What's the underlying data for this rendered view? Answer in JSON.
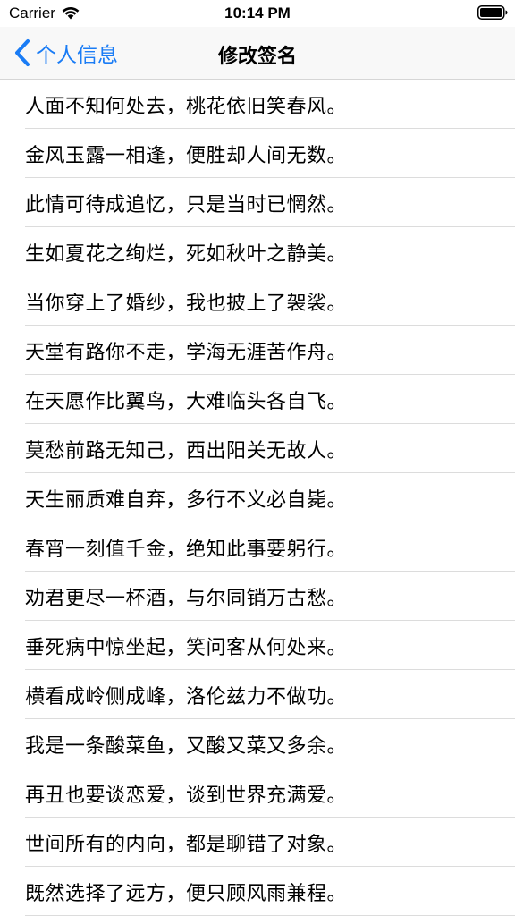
{
  "status_bar": {
    "carrier": "Carrier",
    "time": "10:14 PM"
  },
  "nav": {
    "back_label": "个人信息",
    "title": "修改签名"
  },
  "colors": {
    "accent": "#1a7cf5"
  },
  "icons": {
    "back": "chevron-left-icon",
    "wifi": "wifi-icon",
    "battery": "battery-icon"
  },
  "signatures": [
    "人面不知何处去，桃花依旧笑春风。",
    "金风玉露一相逢，便胜却人间无数。",
    "此情可待成追忆，只是当时已惘然。",
    "生如夏花之绚烂，死如秋叶之静美。",
    "当你穿上了婚纱，我也披上了袈裟。",
    "天堂有路你不走，学海无涯苦作舟。",
    "在天愿作比翼鸟，大难临头各自飞。",
    "莫愁前路无知己，西出阳关无故人。",
    "天生丽质难自弃，多行不义必自毙。",
    "春宵一刻值千金，绝知此事要躬行。",
    "劝君更尽一杯酒，与尔同销万古愁。",
    "垂死病中惊坐起，笑问客从何处来。",
    "横看成岭侧成峰，洛伦兹力不做功。",
    "我是一条酸菜鱼，又酸又菜又多余。",
    "再丑也要谈恋爱，谈到世界充满爱。",
    "世间所有的内向，都是聊错了对象。",
    "既然选择了远方，便只顾风雨兼程。"
  ]
}
